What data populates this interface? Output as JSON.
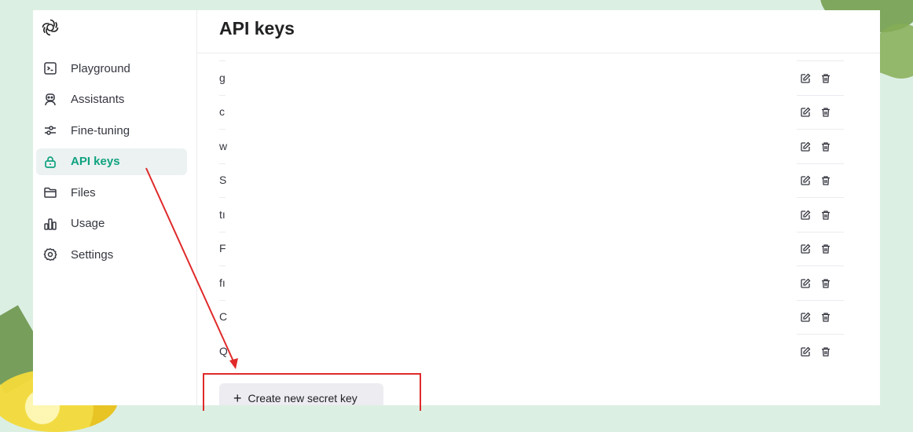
{
  "sidebar": {
    "items": [
      {
        "label": "Playground",
        "icon": "terminal-icon",
        "active": false
      },
      {
        "label": "Assistants",
        "icon": "robot-icon",
        "active": false
      },
      {
        "label": "Fine-tuning",
        "icon": "sliders-icon",
        "active": false
      },
      {
        "label": "API keys",
        "icon": "lock-icon",
        "active": true
      },
      {
        "label": "Files",
        "icon": "folder-icon",
        "active": false
      },
      {
        "label": "Usage",
        "icon": "bar-chart-icon",
        "active": false
      },
      {
        "label": "Settings",
        "icon": "gear-icon",
        "active": false
      }
    ]
  },
  "main": {
    "title": "API keys",
    "keys": [
      {
        "name": "g"
      },
      {
        "name": "c"
      },
      {
        "name": "w"
      },
      {
        "name": "S"
      },
      {
        "name": "tı"
      },
      {
        "name": "F"
      },
      {
        "name": "fı"
      },
      {
        "name": "C"
      },
      {
        "name": "Q"
      }
    ],
    "create_button": "Create new secret key"
  },
  "colors": {
    "accent": "#10a37f",
    "annotation": "#e02a2a",
    "background": "#dcefe3"
  }
}
